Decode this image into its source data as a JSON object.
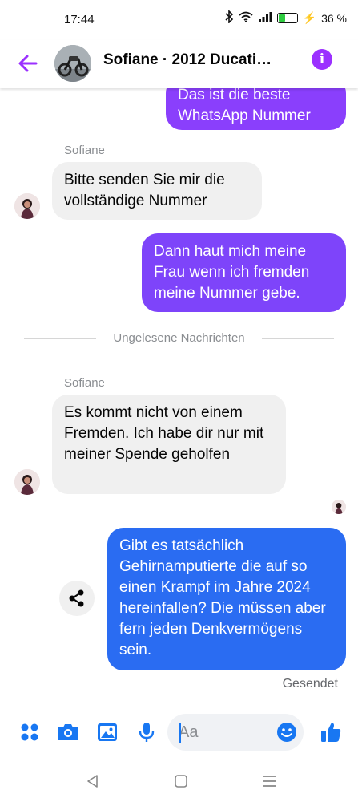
{
  "status_bar": {
    "time": "17:44",
    "battery_percent_label": "36 %",
    "battery_level": 0.36,
    "icons": [
      "bluetooth-icon",
      "wifi-icon",
      "signal-icon",
      "battery-icon",
      "charging-icon"
    ]
  },
  "header": {
    "title": "Sofiane · 2012 Ducati…",
    "back_icon": "arrow-left-icon",
    "info_label": "i",
    "accent": "#9b30ff"
  },
  "messages": [
    {
      "direction": "outgoing",
      "text": "Das ist die beste WhatsApp Nummer"
    },
    {
      "direction": "incoming",
      "sender": "Sofiane",
      "text": "Bitte senden Sie mir die vollständige Nummer"
    },
    {
      "direction": "outgoing",
      "text": "Dann haut mich meine Frau wenn ich fremden meine Nummer gebe."
    },
    {
      "direction": "incoming",
      "sender": "Sofiane",
      "text": "Es kommt nicht von einem Fremden. Ich habe dir nur mit meiner Spende geholfen"
    },
    {
      "direction": "outgoing",
      "text_before": "Gibt es tatsächlich Gehirnamputierte die auf so einen Krampf im Jahre ",
      "link_text": "2024",
      "text_after": " hereinfallen?   Die müssen aber fern jeden Denkvermögens sein."
    }
  ],
  "divider": {
    "label": "Ungelesene Nachrichten"
  },
  "sent_status": "Gesendet",
  "composer": {
    "placeholder": "Aa",
    "icons": [
      "apps-icon",
      "camera-icon",
      "gallery-icon",
      "microphone-icon",
      "emoji-icon",
      "thumbs-up-icon"
    ],
    "accent": "#1877f2"
  },
  "nav_bar": {
    "icons": [
      "back-triangle-icon",
      "home-square-icon",
      "recents-menu-icon"
    ]
  },
  "colors": {
    "outgoing_gradient_top": "#8a3ffc",
    "outgoing_gradient_mid": "#6a4cf5",
    "outgoing_gradient_bottom": "#1f6ef0",
    "incoming_bg": "#f0f0f0"
  }
}
